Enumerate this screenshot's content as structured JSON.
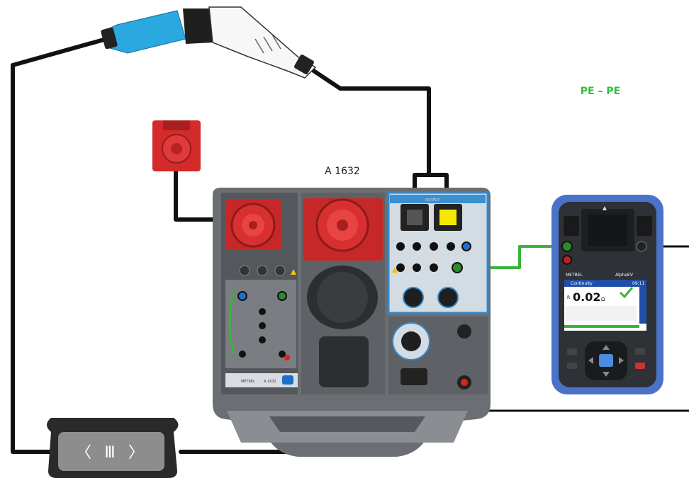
{
  "labels": {
    "device_name": "A 1632",
    "mode": "PE – PE"
  },
  "tester": {
    "screen_title": "Continuity",
    "screen_time": "09:11",
    "reading_prefix": "R",
    "reading_value": "0.02",
    "reading_unit": "Ω",
    "brand": "METREL",
    "model": "AlphaEV"
  },
  "adapter": {
    "left_glyph": "〈",
    "middle_glyph": "Ⅲ",
    "right_glyph": "〉"
  },
  "panel": {
    "brand": "METREL",
    "model": "A 1632"
  },
  "colors": {
    "cable": "#111111",
    "pe_link": "#3bb33b",
    "pe_label": "#2fbf3a",
    "red_socket": "#d8282a",
    "connector_blue": "#2aa8e0",
    "tester_frame": "#4a72c9",
    "highlight_yellow": "#f4e800"
  },
  "icons": [
    "ev-charging-plug-icon",
    "red-plug-icon",
    "emergency-stop-socket-icon",
    "ok-check-icon"
  ]
}
